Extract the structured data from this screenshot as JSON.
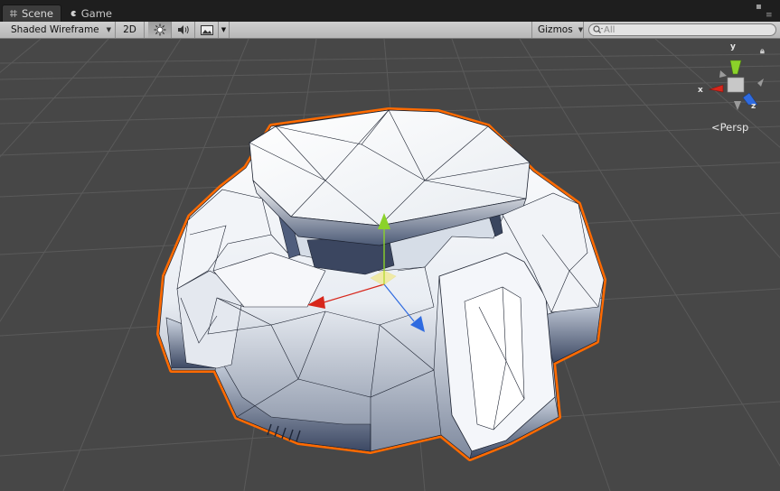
{
  "tabs": [
    {
      "label": "Scene",
      "icon": "scene-grid-icon",
      "active": true
    },
    {
      "label": "Game",
      "icon": "game-pacman-icon",
      "active": false
    }
  ],
  "toolbar": {
    "render_mode": "Shaded Wireframe",
    "mode_2d": "2D",
    "lighting_icon": "sun-icon",
    "audio_icon": "speaker-icon",
    "effects_icon": "image-icon",
    "gizmos": "Gizmos",
    "search_placeholder": "All"
  },
  "orientation_gizmo": {
    "x_label": "x",
    "y_label": "y",
    "z_label": "z",
    "projection": "Persp"
  },
  "colors": {
    "selection_outline": "#ff6a00",
    "grid_background": "#474747",
    "axis_x": "#d7261b",
    "axis_y": "#8bd22a",
    "axis_z": "#2f6be0"
  }
}
